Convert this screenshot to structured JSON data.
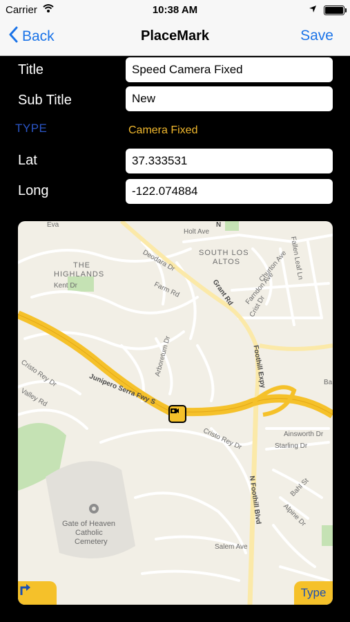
{
  "status": {
    "carrier": "Carrier",
    "time": "10:38 AM"
  },
  "nav": {
    "back_label": "Back",
    "title": "PlaceMark",
    "save_label": "Save"
  },
  "form": {
    "title_label": "Title",
    "title_value": "Speed Camera Fixed",
    "subtitle_label": "Sub Title",
    "subtitle_value": "New",
    "type_label": "TYPE",
    "type_value": "Camera Fixed",
    "lat_label": "Lat",
    "lat_value": "37.333531",
    "long_label": "Long",
    "long_value": "-122.074884"
  },
  "map": {
    "labels": {
      "holt": "Holt Ave",
      "eva": "Eva",
      "south_los_altos_1": "SOUTH LOS",
      "south_los_altos_2": "ALTOS",
      "highlands_1": "THE",
      "highlands_2": "HIGHLANDS",
      "kent": "Kent Dr",
      "deodara": "Deodara Dr",
      "farm": "Farm Rd",
      "grant": "Grant Rd",
      "churton": "Churton Ave",
      "farndon": "Farndon Ave",
      "crist": "Crist Dr",
      "fallen_leaf": "Fallen Leaf Ln",
      "arboretum": "Arboretum Dr",
      "foothill_expy": "Foothill Expy",
      "junipero": "Junipero Serra Fwy S",
      "cristo_rey_left": "Cristo Rey Dr",
      "valley": "Valley Rd",
      "cristo_rey": "Cristo Rey Dr",
      "ainsworth": "Ainsworth Dr",
      "starling": "Starling Dr",
      "bahl": "Bahl St",
      "alpine": "Alpine Dr",
      "n_foothill": "N Foothill Blvd",
      "cemetery_1": "Gate of Heaven",
      "cemetery_2": "Catholic",
      "cemetery_3": "Cemetery",
      "salem": "Salem Ave",
      "ba": "Ba",
      "n": "N"
    },
    "type_button": "Type",
    "accent": "#f5c12a"
  }
}
